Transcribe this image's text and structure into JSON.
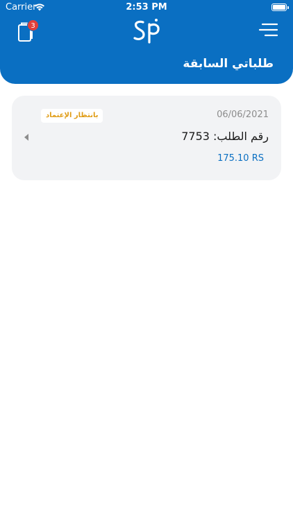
{
  "status_bar": {
    "carrier": "Carrier",
    "time": "2:53 PM"
  },
  "header": {
    "cart_count": "3",
    "logo_text": "SP",
    "title": "طلباتي السابقة",
    "color": "#0a6fc2"
  },
  "icons": {
    "cart": "cart-icon",
    "menu": "menu-icon",
    "chevron": "chevron-left-icon",
    "wifi": "wifi-icon",
    "battery": "battery-icon"
  },
  "orders": [
    {
      "date": "06/06/2021",
      "status": "بانتظار الإعتماد",
      "number_label": "رقم الطلب: 7753",
      "total": "175.10 RS",
      "status_color": "#e09c14"
    }
  ]
}
